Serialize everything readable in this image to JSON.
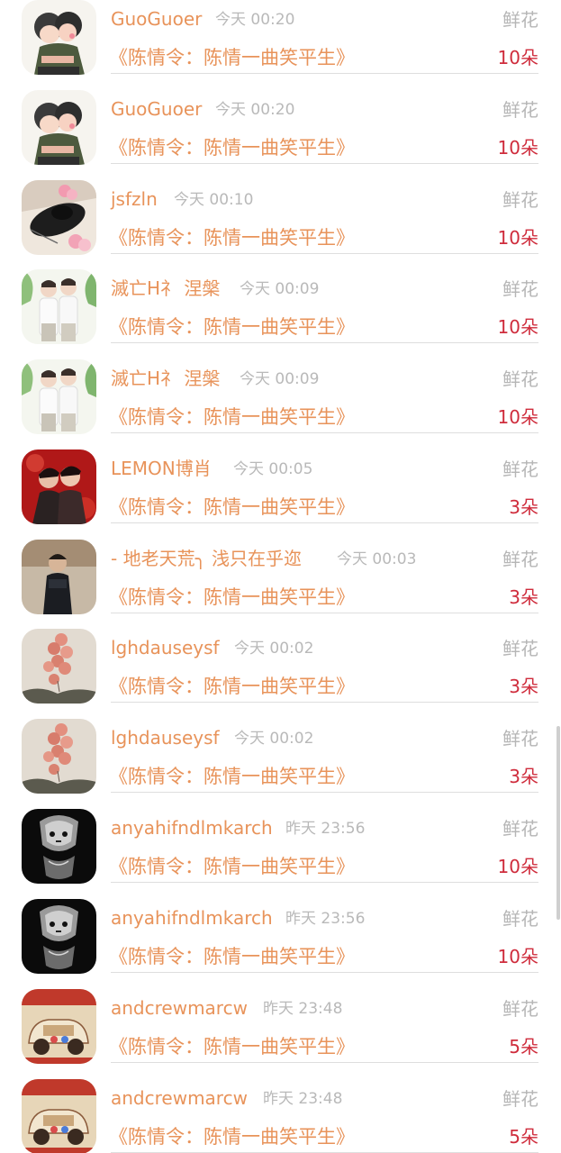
{
  "records": [
    {
      "user": "GuoGuoer",
      "time": "今天 00:20",
      "type": "鲜花",
      "book": "《陈情令：陈情一曲笑平生》",
      "count": "10朵",
      "avatar": "couple-cartoon-avatar"
    },
    {
      "user": "GuoGuoer",
      "time": "今天 00:20",
      "type": "鲜花",
      "book": "《陈情令：陈情一曲笑平生》",
      "count": "10朵",
      "avatar": "couple-cartoon-avatar"
    },
    {
      "user": "jsfzln",
      "time": "今天 00:10",
      "type": "鲜花",
      "book": "《陈情令：陈情一曲笑平生》",
      "count": "10朵",
      "avatar": "hat-flowers-avatar"
    },
    {
      "user": "滅亡H礻 涅槃",
      "time": "今天 00:09",
      "type": "鲜花",
      "book": "《陈情令：陈情一曲笑平生》",
      "count": "10朵",
      "avatar": "two-boys-avatar"
    },
    {
      "user": "滅亡H礻 涅槃",
      "time": "今天 00:09",
      "type": "鲜花",
      "book": "《陈情令：陈情一曲笑平生》",
      "count": "10朵",
      "avatar": "two-boys-avatar"
    },
    {
      "user": "LEMON博肖",
      "time": "今天 00:05",
      "type": "鲜花",
      "book": "《陈情令：陈情一曲笑平生》",
      "count": "3朵",
      "avatar": "red-duo-avatar"
    },
    {
      "user": "- 地老天荒╮ 浅只在乎迩",
      "time": "今天 00:03",
      "type": "鲜花",
      "book": "《陈情令：陈情一曲笑平生》",
      "count": "3朵",
      "avatar": "child-portrait-avatar"
    },
    {
      "user": "lghdauseysf",
      "time": "今天 00:02",
      "type": "鲜花",
      "book": "《陈情令：陈情一曲笑平生》",
      "count": "3朵",
      "avatar": "balloons-avatar"
    },
    {
      "user": "lghdauseysf",
      "time": "今天 00:02",
      "type": "鲜花",
      "book": "《陈情令：陈情一曲笑平生》",
      "count": "3朵",
      "avatar": "balloons-avatar"
    },
    {
      "user": "anyahifndlmkarch",
      "time": "昨天 23:56",
      "type": "鲜花",
      "book": "《陈情令：陈情一曲笑平生》",
      "count": "10朵",
      "avatar": "dark-mask-avatar"
    },
    {
      "user": "anyahifndlmkarch",
      "time": "昨天 23:56",
      "type": "鲜花",
      "book": "《陈情令：陈情一曲笑平生》",
      "count": "10朵",
      "avatar": "dark-mask-avatar"
    },
    {
      "user": "andcrewmarcw",
      "time": "昨天 23:48",
      "type": "鲜花",
      "book": "《陈情令：陈情一曲笑平生》",
      "count": "5朵",
      "avatar": "vintage-car-avatar"
    },
    {
      "user": "andcrewmarcw",
      "time": "昨天 23:48",
      "type": "鲜花",
      "book": "《陈情令：陈情一曲笑平生》",
      "count": "5朵",
      "avatar": "vintage-car-avatar"
    }
  ],
  "colors": {
    "username": "#e8935a",
    "book_title": "#e8935a",
    "timestamp": "#b9b9b9",
    "gift_type": "#b6b6b6",
    "gift_count": "#cf2c3c",
    "divider": "#dedede"
  }
}
